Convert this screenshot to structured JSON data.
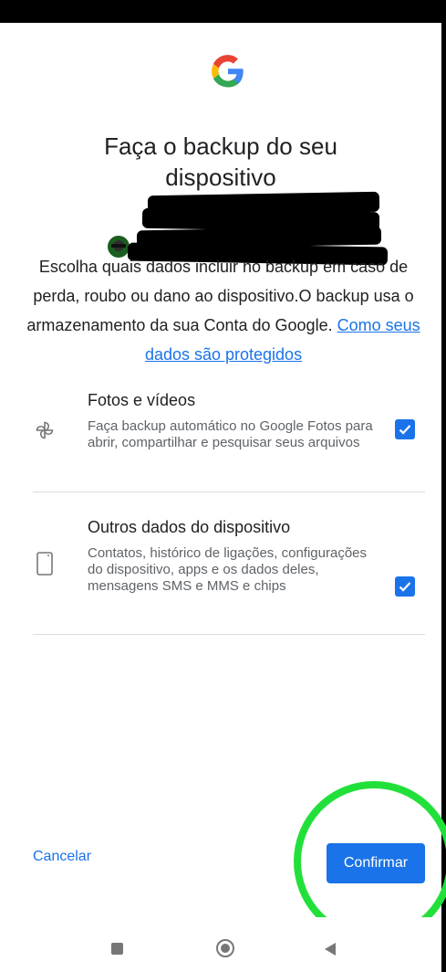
{
  "header": {
    "logo_icon": "google-g-icon",
    "title": "Faça o backup do seu dispositivo"
  },
  "description": {
    "text": "Escolha quais dados incluir no backup em caso de perda, roubo ou dano ao dispositivo.O backup usa o armazenamento da sua Conta do Google. ",
    "link": "Como seus dados são protegidos"
  },
  "options": [
    {
      "icon": "pinwheel-icon",
      "title": "Fotos e vídeos",
      "description": "Faça backup automático no Google Fotos para abrir, compartilhar e pesquisar seus arquivos",
      "checked": true
    },
    {
      "icon": "phone-icon",
      "title": "Outros dados do dispositivo",
      "description": "Contatos, histórico de ligações, configurações do dispositivo, apps e os dados deles, mensagens SMS e MMS e chips",
      "checked": true
    }
  ],
  "footer": {
    "cancel_label": "Cancelar",
    "confirm_label": "Confirmar"
  },
  "colors": {
    "accent": "#1a73e8",
    "highlight": "#22e03a"
  }
}
